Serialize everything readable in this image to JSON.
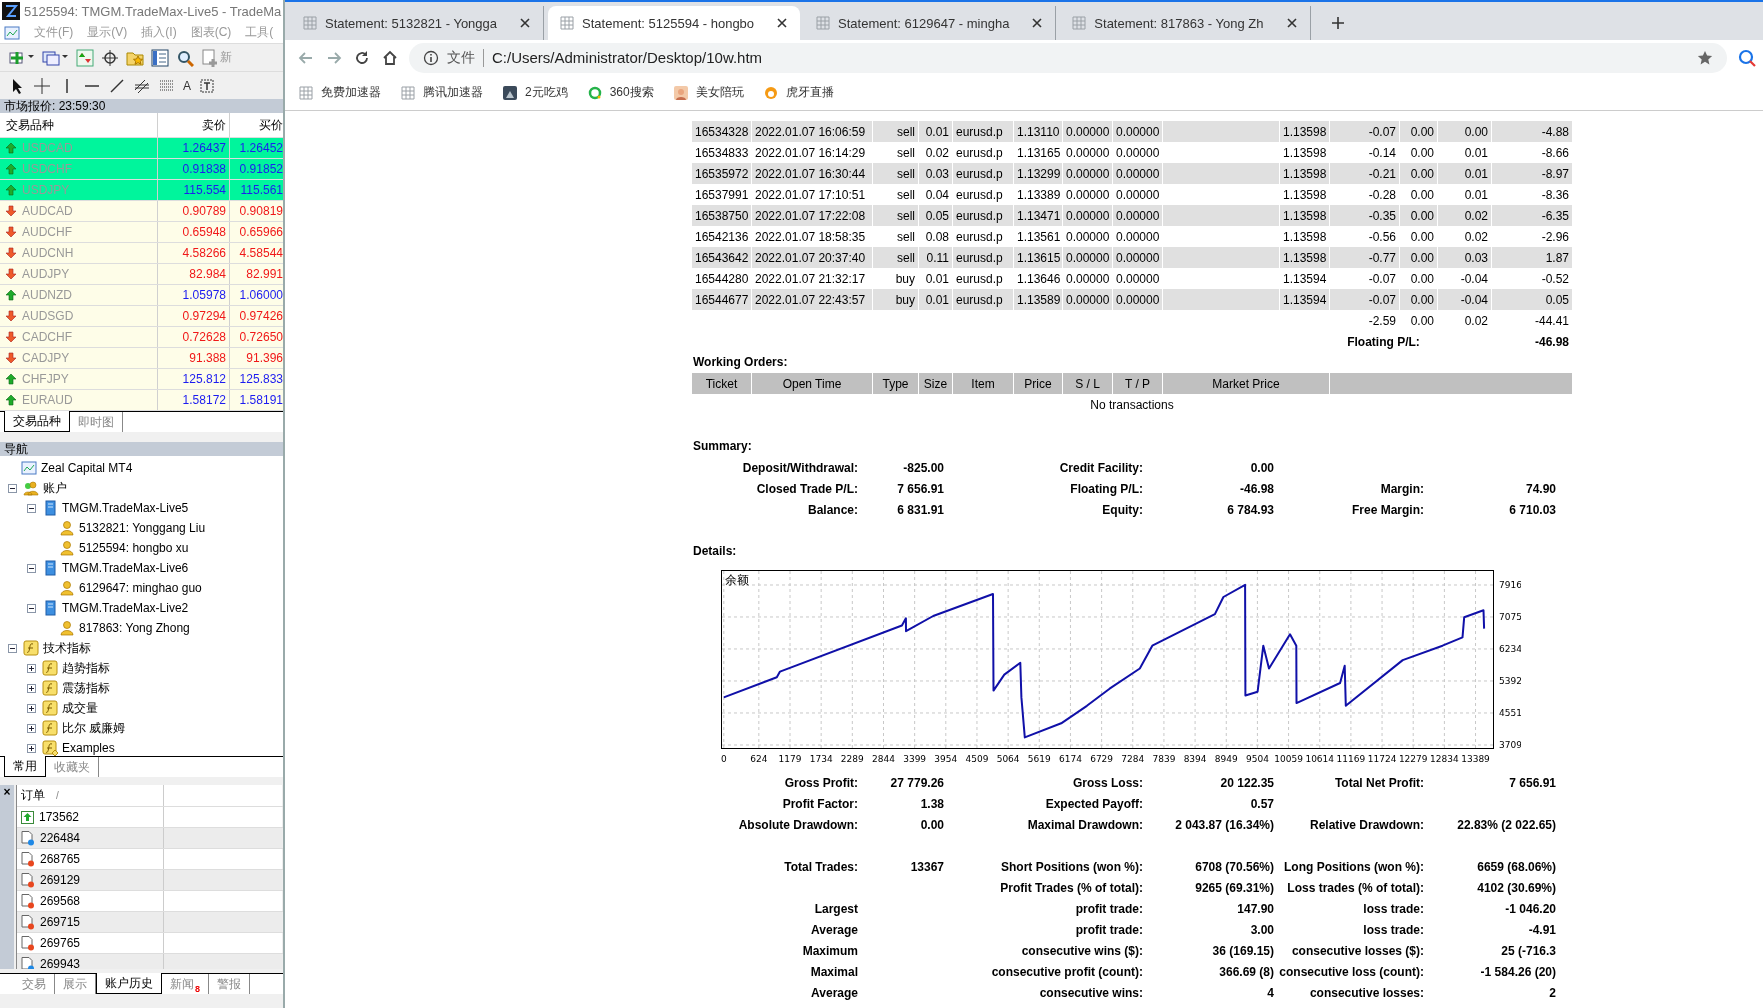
{
  "mt4": {
    "title": "5125594: TMGM.TradeMax-Live5 - TradeMa",
    "menu": [
      "文件(F)",
      "显示(V)",
      "插入(I)",
      "图表(C)",
      "工具("
    ],
    "toolbar_label": "新",
    "drawing_toolbar_glyph": "A",
    "market_watch": {
      "header": "市场报价: 23:59:30",
      "columns": [
        "交易品种",
        "卖价",
        "买价"
      ],
      "rows": [
        {
          "symbol": "USDCAD",
          "bid": "1.26437",
          "ask": "1.26452",
          "rising": true,
          "highlighted": true
        },
        {
          "symbol": "USDCHF",
          "bid": "0.91838",
          "ask": "0.91852",
          "rising": true,
          "highlighted": true
        },
        {
          "symbol": "USDJPY",
          "bid": "115.554",
          "ask": "115.561",
          "rising": true,
          "highlighted": true
        },
        {
          "symbol": "AUDCAD",
          "bid": "0.90789",
          "ask": "0.90819",
          "rising": false,
          "highlighted": false
        },
        {
          "symbol": "AUDCHF",
          "bid": "0.65948",
          "ask": "0.65966",
          "rising": false,
          "highlighted": false
        },
        {
          "symbol": "AUDCNH",
          "bid": "4.58266",
          "ask": "4.58544",
          "rising": false,
          "highlighted": false
        },
        {
          "symbol": "AUDJPY",
          "bid": "82.984",
          "ask": "82.991",
          "rising": false,
          "highlighted": false
        },
        {
          "symbol": "AUDNZD",
          "bid": "1.05978",
          "ask": "1.06000",
          "rising": true,
          "highlighted": false
        },
        {
          "symbol": "AUDSGD",
          "bid": "0.97294",
          "ask": "0.97426",
          "rising": false,
          "highlighted": false
        },
        {
          "symbol": "CADCHF",
          "bid": "0.72628",
          "ask": "0.72650",
          "rising": false,
          "highlighted": false
        },
        {
          "symbol": "CADJPY",
          "bid": "91.388",
          "ask": "91.396",
          "rising": false,
          "highlighted": false
        },
        {
          "symbol": "CHFJPY",
          "bid": "125.812",
          "ask": "125.833",
          "rising": true,
          "highlighted": false
        },
        {
          "symbol": "EURAUD",
          "bid": "1.58172",
          "ask": "1.58191",
          "rising": true,
          "highlighted": false
        }
      ],
      "tabs": [
        {
          "label": "交易品种",
          "selected": true
        },
        {
          "label": "即时图",
          "selected": false
        }
      ]
    },
    "navigator": {
      "title": "导航",
      "tree": [
        {
          "label": "Zeal Capital MT4",
          "kind": "platform",
          "children": [
            {
              "label": "账户",
              "kind": "accounts",
              "expanded": true,
              "children": [
                {
                  "label": "TMGM.TradeMax-Live5",
                  "kind": "server",
                  "expanded": true,
                  "children": [
                    {
                      "label": "5132821: Yonggang Liu",
                      "kind": "account"
                    },
                    {
                      "label": "5125594: hongbo xu",
                      "kind": "account"
                    }
                  ]
                },
                {
                  "label": "TMGM.TradeMax-Live6",
                  "kind": "server",
                  "expanded": true,
                  "children": [
                    {
                      "label": "6129647: minghao guo",
                      "kind": "account"
                    }
                  ]
                },
                {
                  "label": "TMGM.TradeMax-Live2",
                  "kind": "server",
                  "expanded": true,
                  "children": [
                    {
                      "label": "817863: Yong Zhong",
                      "kind": "account"
                    }
                  ]
                }
              ]
            },
            {
              "label": "技术指标",
              "kind": "indicators",
              "expanded": true,
              "children": [
                {
                  "label": "趋势指标",
                  "kind": "indicators",
                  "expanded": false
                },
                {
                  "label": "震荡指标",
                  "kind": "indicators",
                  "expanded": false
                },
                {
                  "label": "成交量",
                  "kind": "indicators",
                  "expanded": false
                },
                {
                  "label": "比尔 威廉姆",
                  "kind": "indicators",
                  "expanded": false
                },
                {
                  "label": "Examples",
                  "kind": "examples",
                  "expanded": false
                }
              ]
            }
          ]
        }
      ],
      "tabs": [
        {
          "label": "常用",
          "selected": true
        },
        {
          "label": "收藏夹",
          "selected": false
        }
      ]
    },
    "terminal": {
      "close": "×",
      "column": "订单",
      "sort_mark": "/",
      "rows": [
        {
          "order": "173562",
          "kind": "arrow"
        },
        {
          "order": "226484",
          "kind": "dot",
          "color": "#1e88e5"
        },
        {
          "order": "268765",
          "kind": "dot",
          "color": "#e8461e"
        },
        {
          "order": "269129",
          "kind": "dot",
          "color": "#e8461e"
        },
        {
          "order": "269568",
          "kind": "dot",
          "color": "#e8461e"
        },
        {
          "order": "269715",
          "kind": "dot",
          "color": "#e8461e"
        },
        {
          "order": "269765",
          "kind": "dot",
          "color": "#e8461e"
        },
        {
          "order": "269943",
          "kind": "dot",
          "color": "#1e88e5"
        }
      ],
      "tabs": [
        {
          "label": "交易",
          "selected": false
        },
        {
          "label": "展示",
          "selected": false
        },
        {
          "label": "账户历史",
          "selected": true
        },
        {
          "label": "新闻",
          "selected": false,
          "badge": "8"
        },
        {
          "label": "警报",
          "selected": false
        }
      ]
    }
  },
  "browser": {
    "tabs": [
      {
        "title": "Statement: 5132821 - Yongga",
        "selected": false
      },
      {
        "title": "Statement: 5125594 - hongbo",
        "selected": true
      },
      {
        "title": "Statement: 6129647 - mingha",
        "selected": false
      },
      {
        "title": "Statement: 817863 - Yong Zh",
        "selected": false
      }
    ],
    "address": {
      "scheme": "文件",
      "url": "C:/Users/Administrator/Desktop/10w.htm"
    },
    "bookmarks": [
      {
        "label": "免费加速器",
        "kind": "grid"
      },
      {
        "label": "腾讯加速器",
        "kind": "grid"
      },
      {
        "label": "2元吃鸡",
        "kind": "app"
      },
      {
        "label": "360搜索",
        "kind": "ring"
      },
      {
        "label": "美女陪玩",
        "kind": "avatar"
      },
      {
        "label": "虎牙直播",
        "kind": "logo"
      }
    ],
    "statement": {
      "open_trades": {
        "rows": [
          [
            "16534328",
            "2022.01.07 16:06:59",
            "sell",
            "0.01",
            "eurusd.p",
            "1.13110",
            "0.00000",
            "0.00000",
            "1.13598",
            "-0.07",
            "0.00",
            "0.00",
            "-4.88"
          ],
          [
            "16534833",
            "2022.01.07 16:14:29",
            "sell",
            "0.02",
            "eurusd.p",
            "1.13165",
            "0.00000",
            "0.00000",
            "1.13598",
            "-0.14",
            "0.00",
            "0.01",
            "-8.66"
          ],
          [
            "16535972",
            "2022.01.07 16:30:44",
            "sell",
            "0.03",
            "eurusd.p",
            "1.13299",
            "0.00000",
            "0.00000",
            "1.13598",
            "-0.21",
            "0.00",
            "0.01",
            "-8.97"
          ],
          [
            "16537991",
            "2022.01.07 17:10:51",
            "sell",
            "0.04",
            "eurusd.p",
            "1.13389",
            "0.00000",
            "0.00000",
            "1.13598",
            "-0.28",
            "0.00",
            "0.01",
            "-8.36"
          ],
          [
            "16538750",
            "2022.01.07 17:22:08",
            "sell",
            "0.05",
            "eurusd.p",
            "1.13471",
            "0.00000",
            "0.00000",
            "1.13598",
            "-0.35",
            "0.00",
            "0.02",
            "-6.35"
          ],
          [
            "16542136",
            "2022.01.07 18:58:35",
            "sell",
            "0.08",
            "eurusd.p",
            "1.13561",
            "0.00000",
            "0.00000",
            "1.13598",
            "-0.56",
            "0.00",
            "0.02",
            "-2.96"
          ],
          [
            "16543642",
            "2022.01.07 20:37:40",
            "sell",
            "0.11",
            "eurusd.p",
            "1.13615",
            "0.00000",
            "0.00000",
            "1.13598",
            "-0.77",
            "0.00",
            "0.03",
            "1.87"
          ],
          [
            "16544280",
            "2022.01.07 21:32:17",
            "buy",
            "0.01",
            "eurusd.p",
            "1.13646",
            "0.00000",
            "0.00000",
            "1.13594",
            "-0.07",
            "0.00",
            "-0.04",
            "-0.52"
          ],
          [
            "16544677",
            "2022.01.07 22:43:57",
            "buy",
            "0.01",
            "eurusd.p",
            "1.13589",
            "0.00000",
            "0.00000",
            "1.13594",
            "-0.07",
            "0.00",
            "-0.04",
            "0.05"
          ]
        ],
        "totals": [
          "-2.59",
          "0.00",
          "0.02",
          "-44.41"
        ],
        "floating_label": "Floating P/L:",
        "floating_value": "-46.98"
      },
      "working_orders": {
        "title": "Working Orders:",
        "columns": [
          "Ticket",
          "Open Time",
          "Type",
          "Size",
          "Item",
          "Price",
          "S / L",
          "T / P",
          "Market Price"
        ],
        "empty_text": "No transactions"
      },
      "summary": {
        "title": "Summary:",
        "rows": [
          {
            "left": {
              "label": "Deposit/Withdrawal:",
              "value": "-825.00"
            },
            "middle": {
              "label": "Credit Facility:",
              "value": "0.00"
            }
          },
          {
            "left": {
              "label": "Closed Trade P/L:",
              "value": "7 656.91"
            },
            "middle": {
              "label": "Floating P/L:",
              "value": "-46.98"
            },
            "right": {
              "label": "Margin:",
              "value": "74.90"
            }
          },
          {
            "left": {
              "label": "Balance:",
              "value": "6 831.91"
            },
            "middle": {
              "label": "Equity:",
              "value": "6 784.93"
            },
            "right": {
              "label": "Free Margin:",
              "value": "6 710.03"
            }
          }
        ]
      },
      "details": {
        "title": "Details:",
        "chart_data": {
          "type": "line",
          "title": "余额",
          "x": [
            0,
            943,
            1000,
            3172,
            3243,
            3245,
            3730,
            4794,
            4804,
            4996,
            5280,
            5300,
            5361,
            6010,
            6467,
            6872,
            7409,
            7632,
            8747,
            8899,
            9284,
            9290,
            9507,
            9608,
            9710,
            10085,
            10196,
            10200,
            10977,
            11058,
            11078,
            12092,
            12801,
            13156,
            13187,
            13531,
            13541
          ],
          "values": [
            4960,
            5490,
            5640,
            6850,
            7040,
            6700,
            7100,
            7680,
            5140,
            5560,
            5870,
            4960,
            3910,
            4280,
            4740,
            5190,
            5720,
            6320,
            7150,
            7600,
            7920,
            5010,
            5110,
            6320,
            5720,
            6620,
            6320,
            4810,
            5340,
            5790,
            4740,
            5940,
            6320,
            6540,
            7070,
            7250,
            6770
          ],
          "xlim": [
            -50,
            13700
          ],
          "ylim": [
            3630,
            8310
          ],
          "grid": true,
          "xticks": [
            0,
            624,
            1179,
            1734,
            2289,
            2844,
            3399,
            3954,
            4509,
            5064,
            5619,
            6174,
            6729,
            7284,
            7839,
            8394,
            8949,
            9504,
            10059,
            10614,
            11169,
            11724,
            12279,
            12834,
            13389
          ],
          "yticks": [
            3709,
            4551,
            5392,
            6234,
            7075,
            7916
          ]
        }
      },
      "stats": [
        [
          {
            "left": {
              "label": "Gross Profit:",
              "value": "27 779.26"
            },
            "middle": {
              "label": "Gross Loss:",
              "value": "20 122.35"
            },
            "right": {
              "label": "Total Net Profit:",
              "value": "7 656.91"
            }
          },
          {
            "left": {
              "label": "Profit Factor:",
              "value": "1.38"
            },
            "middle": {
              "label": "Expected Payoff:",
              "value": "0.57"
            }
          },
          {
            "left": {
              "label": "Absolute Drawdown:",
              "value": "0.00"
            },
            "middle": {
              "label": "Maximal Drawdown:",
              "value": "2 043.87 (16.34%)"
            },
            "right": {
              "label": "Relative Drawdown:",
              "value": "22.83% (2 022.65)"
            }
          }
        ],
        [
          {
            "left": {
              "label": "Total Trades:",
              "value": "13367"
            },
            "middle": {
              "label": "Short Positions (won %):",
              "value": "6708 (70.56%)"
            },
            "right": {
              "label": "Long Positions (won %):",
              "value": "6659 (68.06%)"
            }
          },
          {
            "middle": {
              "label": "Profit Trades (% of total):",
              "value": "9265 (69.31%)"
            },
            "right": {
              "label": "Loss trades (% of total):",
              "value": "4102 (30.69%)"
            }
          },
          {
            "left": {
              "label": "Largest"
            },
            "middle": {
              "label": "profit trade:",
              "value": "147.90"
            },
            "right": {
              "label": "loss trade:",
              "value": "-1 046.20"
            }
          },
          {
            "left": {
              "label": "Average"
            },
            "middle": {
              "label": "profit trade:",
              "value": "3.00"
            },
            "right": {
              "label": "loss trade:",
              "value": "-4.91"
            }
          },
          {
            "left": {
              "label": "Maximum"
            },
            "middle": {
              "label": "consecutive wins ($):",
              "value": "36 (169.15)"
            },
            "right": {
              "label": "consecutive losses ($):",
              "value": "25 (-716.3"
            }
          },
          {
            "left": {
              "label": "Maximal"
            },
            "middle": {
              "label": "consecutive profit (count):",
              "value": "366.69 (8)"
            },
            "right": {
              "label": "consecutive loss (count):",
              "value": "-1 584.26 (20)"
            }
          },
          {
            "left": {
              "label": "Average"
            },
            "middle": {
              "label": "consecutive wins:",
              "value": "4"
            },
            "right": {
              "label": "consecutive losses:",
              "value": "2"
            }
          }
        ]
      ]
    }
  }
}
